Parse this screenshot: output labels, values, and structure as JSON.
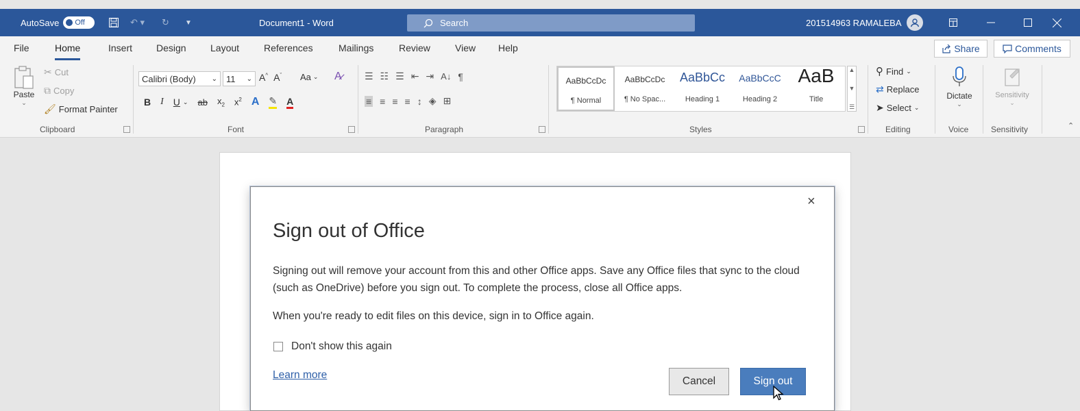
{
  "title_bar": {
    "autosave_label": "AutoSave",
    "autosave_state": "Off",
    "document_title": "Document1  -  Word",
    "search_placeholder": "Search",
    "user_name": "201514963 RAMALEBA",
    "colors": {
      "background": "#2b579a",
      "search_background": "#7f9bc7"
    }
  },
  "menu_tabs": [
    "File",
    "Home",
    "Insert",
    "Design",
    "Layout",
    "References",
    "Mailings",
    "Review",
    "View",
    "Help"
  ],
  "active_tab": "Home",
  "share_label": "Share",
  "comments_label": "Comments",
  "ribbon": {
    "clipboard": {
      "paste": "Paste",
      "cut": "Cut",
      "copy": "Copy",
      "format_painter": "Format Painter",
      "group": "Clipboard"
    },
    "font": {
      "font_name": "Calibri (Body)",
      "font_size": "11",
      "change_case": "Aa",
      "group": "Font"
    },
    "paragraph": {
      "group": "Paragraph"
    },
    "styles": {
      "items": [
        {
          "sample": "AaBbCcDc",
          "name": "¶ Normal"
        },
        {
          "sample": "AaBbCcDc",
          "name": "¶ No Spac..."
        },
        {
          "sample": "AaBbCc",
          "name": "Heading 1"
        },
        {
          "sample": "AaBbCcC",
          "name": "Heading 2"
        },
        {
          "sample": "AaB",
          "name": "Title"
        }
      ],
      "group": "Styles"
    },
    "editing": {
      "find": "Find",
      "replace": "Replace",
      "select": "Select",
      "group": "Editing"
    },
    "voice": {
      "dictate": "Dictate",
      "group": "Voice"
    },
    "sensitivity": {
      "label": "Sensitivity",
      "group": "Sensitivity"
    }
  },
  "dialog": {
    "title": "Sign out of Office",
    "message_1": "Signing out will remove your account from this and other Office apps. Save any Office files that sync to the cloud (such as OneDrive) before you sign out. To complete the process, close all Office apps.",
    "message_2": "When you're ready to edit files on this device, sign in to Office again.",
    "checkbox_label": "Don't show this again",
    "checkbox_checked": false,
    "learn_more": "Learn more",
    "cancel": "Cancel",
    "sign_out": "Sign out",
    "close_symbol": "×",
    "colors": {
      "primary_button": "#4a7dbd",
      "link": "#2e5fa8"
    }
  }
}
